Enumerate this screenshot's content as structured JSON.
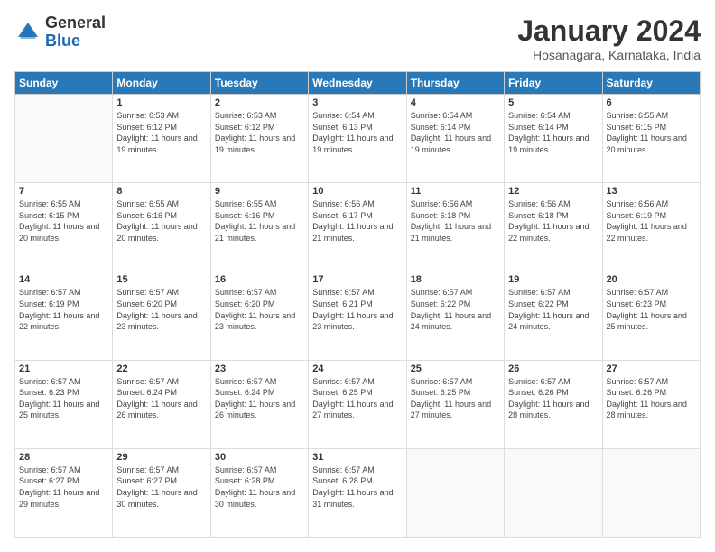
{
  "logo": {
    "general": "General",
    "blue": "Blue"
  },
  "calendar": {
    "title": "January 2024",
    "subtitle": "Hosanagara, Karnataka, India"
  },
  "headers": [
    "Sunday",
    "Monday",
    "Tuesday",
    "Wednesday",
    "Thursday",
    "Friday",
    "Saturday"
  ],
  "weeks": [
    [
      {
        "day": "",
        "sunrise": "",
        "sunset": "",
        "daylight": ""
      },
      {
        "day": "1",
        "sunrise": "Sunrise: 6:53 AM",
        "sunset": "Sunset: 6:12 PM",
        "daylight": "Daylight: 11 hours and 19 minutes."
      },
      {
        "day": "2",
        "sunrise": "Sunrise: 6:53 AM",
        "sunset": "Sunset: 6:12 PM",
        "daylight": "Daylight: 11 hours and 19 minutes."
      },
      {
        "day": "3",
        "sunrise": "Sunrise: 6:54 AM",
        "sunset": "Sunset: 6:13 PM",
        "daylight": "Daylight: 11 hours and 19 minutes."
      },
      {
        "day": "4",
        "sunrise": "Sunrise: 6:54 AM",
        "sunset": "Sunset: 6:14 PM",
        "daylight": "Daylight: 11 hours and 19 minutes."
      },
      {
        "day": "5",
        "sunrise": "Sunrise: 6:54 AM",
        "sunset": "Sunset: 6:14 PM",
        "daylight": "Daylight: 11 hours and 19 minutes."
      },
      {
        "day": "6",
        "sunrise": "Sunrise: 6:55 AM",
        "sunset": "Sunset: 6:15 PM",
        "daylight": "Daylight: 11 hours and 20 minutes."
      }
    ],
    [
      {
        "day": "7",
        "sunrise": "Sunrise: 6:55 AM",
        "sunset": "Sunset: 6:15 PM",
        "daylight": "Daylight: 11 hours and 20 minutes."
      },
      {
        "day": "8",
        "sunrise": "Sunrise: 6:55 AM",
        "sunset": "Sunset: 6:16 PM",
        "daylight": "Daylight: 11 hours and 20 minutes."
      },
      {
        "day": "9",
        "sunrise": "Sunrise: 6:55 AM",
        "sunset": "Sunset: 6:16 PM",
        "daylight": "Daylight: 11 hours and 21 minutes."
      },
      {
        "day": "10",
        "sunrise": "Sunrise: 6:56 AM",
        "sunset": "Sunset: 6:17 PM",
        "daylight": "Daylight: 11 hours and 21 minutes."
      },
      {
        "day": "11",
        "sunrise": "Sunrise: 6:56 AM",
        "sunset": "Sunset: 6:18 PM",
        "daylight": "Daylight: 11 hours and 21 minutes."
      },
      {
        "day": "12",
        "sunrise": "Sunrise: 6:56 AM",
        "sunset": "Sunset: 6:18 PM",
        "daylight": "Daylight: 11 hours and 22 minutes."
      },
      {
        "day": "13",
        "sunrise": "Sunrise: 6:56 AM",
        "sunset": "Sunset: 6:19 PM",
        "daylight": "Daylight: 11 hours and 22 minutes."
      }
    ],
    [
      {
        "day": "14",
        "sunrise": "Sunrise: 6:57 AM",
        "sunset": "Sunset: 6:19 PM",
        "daylight": "Daylight: 11 hours and 22 minutes."
      },
      {
        "day": "15",
        "sunrise": "Sunrise: 6:57 AM",
        "sunset": "Sunset: 6:20 PM",
        "daylight": "Daylight: 11 hours and 23 minutes."
      },
      {
        "day": "16",
        "sunrise": "Sunrise: 6:57 AM",
        "sunset": "Sunset: 6:20 PM",
        "daylight": "Daylight: 11 hours and 23 minutes."
      },
      {
        "day": "17",
        "sunrise": "Sunrise: 6:57 AM",
        "sunset": "Sunset: 6:21 PM",
        "daylight": "Daylight: 11 hours and 23 minutes."
      },
      {
        "day": "18",
        "sunrise": "Sunrise: 6:57 AM",
        "sunset": "Sunset: 6:22 PM",
        "daylight": "Daylight: 11 hours and 24 minutes."
      },
      {
        "day": "19",
        "sunrise": "Sunrise: 6:57 AM",
        "sunset": "Sunset: 6:22 PM",
        "daylight": "Daylight: 11 hours and 24 minutes."
      },
      {
        "day": "20",
        "sunrise": "Sunrise: 6:57 AM",
        "sunset": "Sunset: 6:23 PM",
        "daylight": "Daylight: 11 hours and 25 minutes."
      }
    ],
    [
      {
        "day": "21",
        "sunrise": "Sunrise: 6:57 AM",
        "sunset": "Sunset: 6:23 PM",
        "daylight": "Daylight: 11 hours and 25 minutes."
      },
      {
        "day": "22",
        "sunrise": "Sunrise: 6:57 AM",
        "sunset": "Sunset: 6:24 PM",
        "daylight": "Daylight: 11 hours and 26 minutes."
      },
      {
        "day": "23",
        "sunrise": "Sunrise: 6:57 AM",
        "sunset": "Sunset: 6:24 PM",
        "daylight": "Daylight: 11 hours and 26 minutes."
      },
      {
        "day": "24",
        "sunrise": "Sunrise: 6:57 AM",
        "sunset": "Sunset: 6:25 PM",
        "daylight": "Daylight: 11 hours and 27 minutes."
      },
      {
        "day": "25",
        "sunrise": "Sunrise: 6:57 AM",
        "sunset": "Sunset: 6:25 PM",
        "daylight": "Daylight: 11 hours and 27 minutes."
      },
      {
        "day": "26",
        "sunrise": "Sunrise: 6:57 AM",
        "sunset": "Sunset: 6:26 PM",
        "daylight": "Daylight: 11 hours and 28 minutes."
      },
      {
        "day": "27",
        "sunrise": "Sunrise: 6:57 AM",
        "sunset": "Sunset: 6:26 PM",
        "daylight": "Daylight: 11 hours and 28 minutes."
      }
    ],
    [
      {
        "day": "28",
        "sunrise": "Sunrise: 6:57 AM",
        "sunset": "Sunset: 6:27 PM",
        "daylight": "Daylight: 11 hours and 29 minutes."
      },
      {
        "day": "29",
        "sunrise": "Sunrise: 6:57 AM",
        "sunset": "Sunset: 6:27 PM",
        "daylight": "Daylight: 11 hours and 30 minutes."
      },
      {
        "day": "30",
        "sunrise": "Sunrise: 6:57 AM",
        "sunset": "Sunset: 6:28 PM",
        "daylight": "Daylight: 11 hours and 30 minutes."
      },
      {
        "day": "31",
        "sunrise": "Sunrise: 6:57 AM",
        "sunset": "Sunset: 6:28 PM",
        "daylight": "Daylight: 11 hours and 31 minutes."
      },
      {
        "day": "",
        "sunrise": "",
        "sunset": "",
        "daylight": ""
      },
      {
        "day": "",
        "sunrise": "",
        "sunset": "",
        "daylight": ""
      },
      {
        "day": "",
        "sunrise": "",
        "sunset": "",
        "daylight": ""
      }
    ]
  ]
}
